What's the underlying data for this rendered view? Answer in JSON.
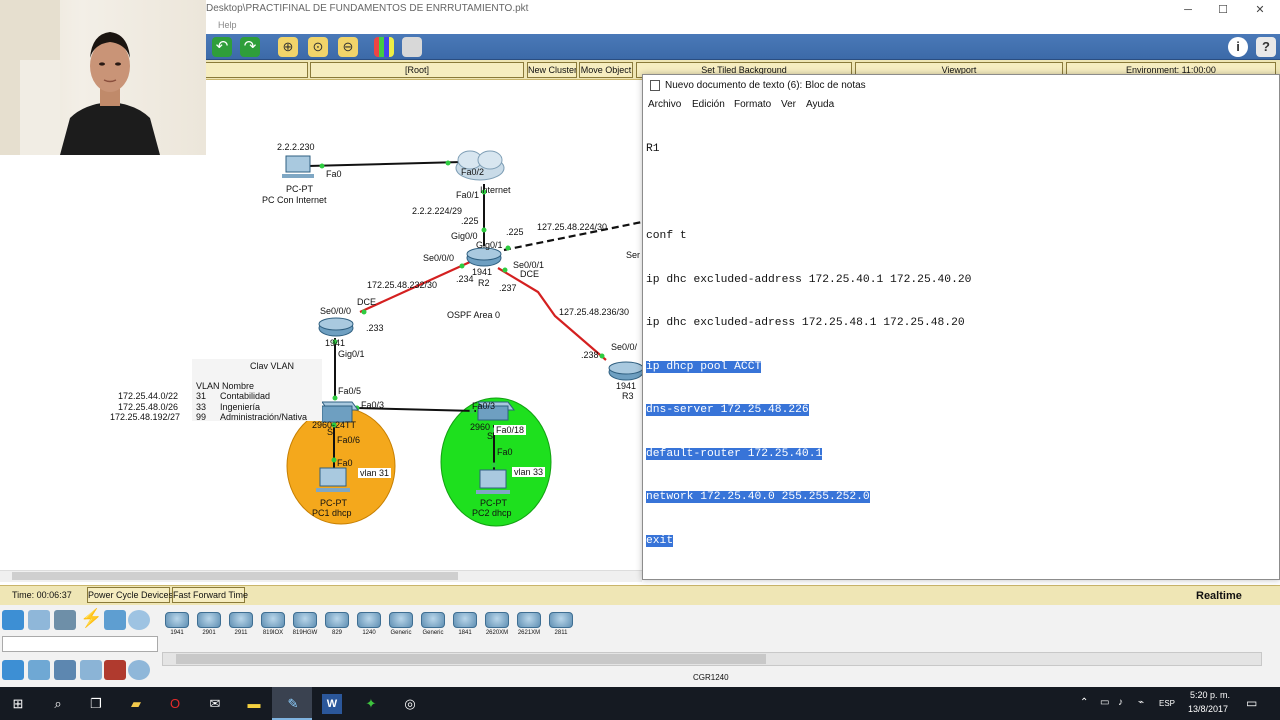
{
  "packet_tracer": {
    "title": "Desktop\\PRACTIFINAL DE FUNDAMENTOS DE ENRRUTAMIENTO.pkt",
    "menu_help": "Help",
    "navbar": {
      "root": "[Root]",
      "new_cluster": "New Cluster",
      "move_object": "Move Object",
      "set_tiled_background": "Set Tiled Background",
      "viewport": "Viewport",
      "environment": "Environment: 11:00:00"
    },
    "workspace": {
      "labels": {
        "pc_internet_ip": "2.2.2.230",
        "pc_internet_model": "PC-PT",
        "pc_internet_name": "PC Con Internet",
        "pc_internet_port": "Fa0",
        "cloud_port_fa02": "Fa0/2",
        "cloud_name": "Internet",
        "cloud_port_fa01": "Fa0/1",
        "link_net_2": "2.2.2.224/29",
        "r2_ip_225a": ".225",
        "r2_gig00": "Gig0/0",
        "r2_gig01": "Gig0/1",
        "r2_ip_225b": ".225",
        "link_net_server": "127.25.48.224/30",
        "server_cut": "Ser",
        "r2_se000": "Se0/0/0",
        "r2_se001": "Se0/0/1",
        "r2_dce": "DCE",
        "r2_model": "1941",
        "r2_name": "R2",
        "r2_ip_234": ".234",
        "r2_ip_237": ".237",
        "link_net_r1r2": "172.25.48.232/30",
        "link_net_r2r3": "127.25.48.236/30",
        "r1_dce": "DCE",
        "r1_se000": "Se0/0/0",
        "r1_ip_233": ".233",
        "r1_model": "1941",
        "r1_gig01": "Gig0/1",
        "ospf": "OSPF Area 0",
        "r3_se00": "Se0/0/",
        "r3_ip_238": ".238",
        "r3_model": "1941",
        "r3_name": "R3",
        "vlan_title": "Clav VLAN",
        "vlan_header": "VLAN  Nombre",
        "sw1_fa05": "Fa0/5",
        "sw1_fa03": "Fa0/3",
        "sw1_model": "2960-24TT",
        "sw1_name": "S",
        "sw1_fa06": "Fa0/6",
        "pc1_fa0": "Fa0",
        "pc1_vlan": "vlan 31",
        "pc1_model": "PC-PT",
        "pc1_name": "PC1 dhcp",
        "sw2_fa03": "Fa0/3",
        "sw2_model": "2960",
        "sw2_name": "S",
        "sw2_fa018": "Fa0/18",
        "pc2_fa0": "Fa0",
        "pc2_vlan": "vlan 33",
        "pc2_model": "PC-PT",
        "pc2_name": "PC2 dhcp"
      },
      "vlan_table": [
        {
          "net": "172.25.44.0/22",
          "id": "31",
          "name": "Contabilidad"
        },
        {
          "net": "172.25.48.0/26",
          "id": "33",
          "name": "Ingeniería"
        },
        {
          "net": "172.25.48.192/27",
          "id": "99",
          "name": "Administración/Nativa"
        }
      ]
    },
    "time": "Time: 00:06:37",
    "power_cycle": "Power Cycle Devices",
    "fast_forward": "Fast Forward Time",
    "realtime": "Realtime",
    "device_list": [
      "1941",
      "2901",
      "2911",
      "819IOX",
      "819HGW",
      "829",
      "1240",
      "Generic",
      "Generic",
      "1841",
      "2620XM",
      "2621XM",
      "2811"
    ],
    "selected_device": "CGR1240"
  },
  "notepad": {
    "title": "Nuevo documento de texto (6): Bloc de notas",
    "menu": {
      "archivo": "Archivo",
      "edicion": "Edición",
      "formato": "Formato",
      "ver": "Ver",
      "ayuda": "Ayuda"
    },
    "lines": [
      "R1",
      "",
      "conf t",
      "ip dhc excluded-address 172.25.40.1 172.25.40.20",
      "ip dhc excluded-adress 172.25.48.1 172.25.48.20",
      "ip dhcp pool ACCT",
      "dns-server 172.25.48.226",
      "default-router 172.25.40.1",
      "network 172.25.40.0 255.255.252.0",
      "exit"
    ]
  },
  "taskbar": {
    "language": "ESP",
    "time": "5:20 p. m.",
    "date": "13/8/2017"
  },
  "colors": {
    "serial_link": "#d42020",
    "vlan31_zone": "#f4a81c",
    "vlan33_zone": "#1ee01e",
    "selection": "#3874d8",
    "toolbar": "#4a79b8",
    "navbar": "#efe6b5"
  }
}
